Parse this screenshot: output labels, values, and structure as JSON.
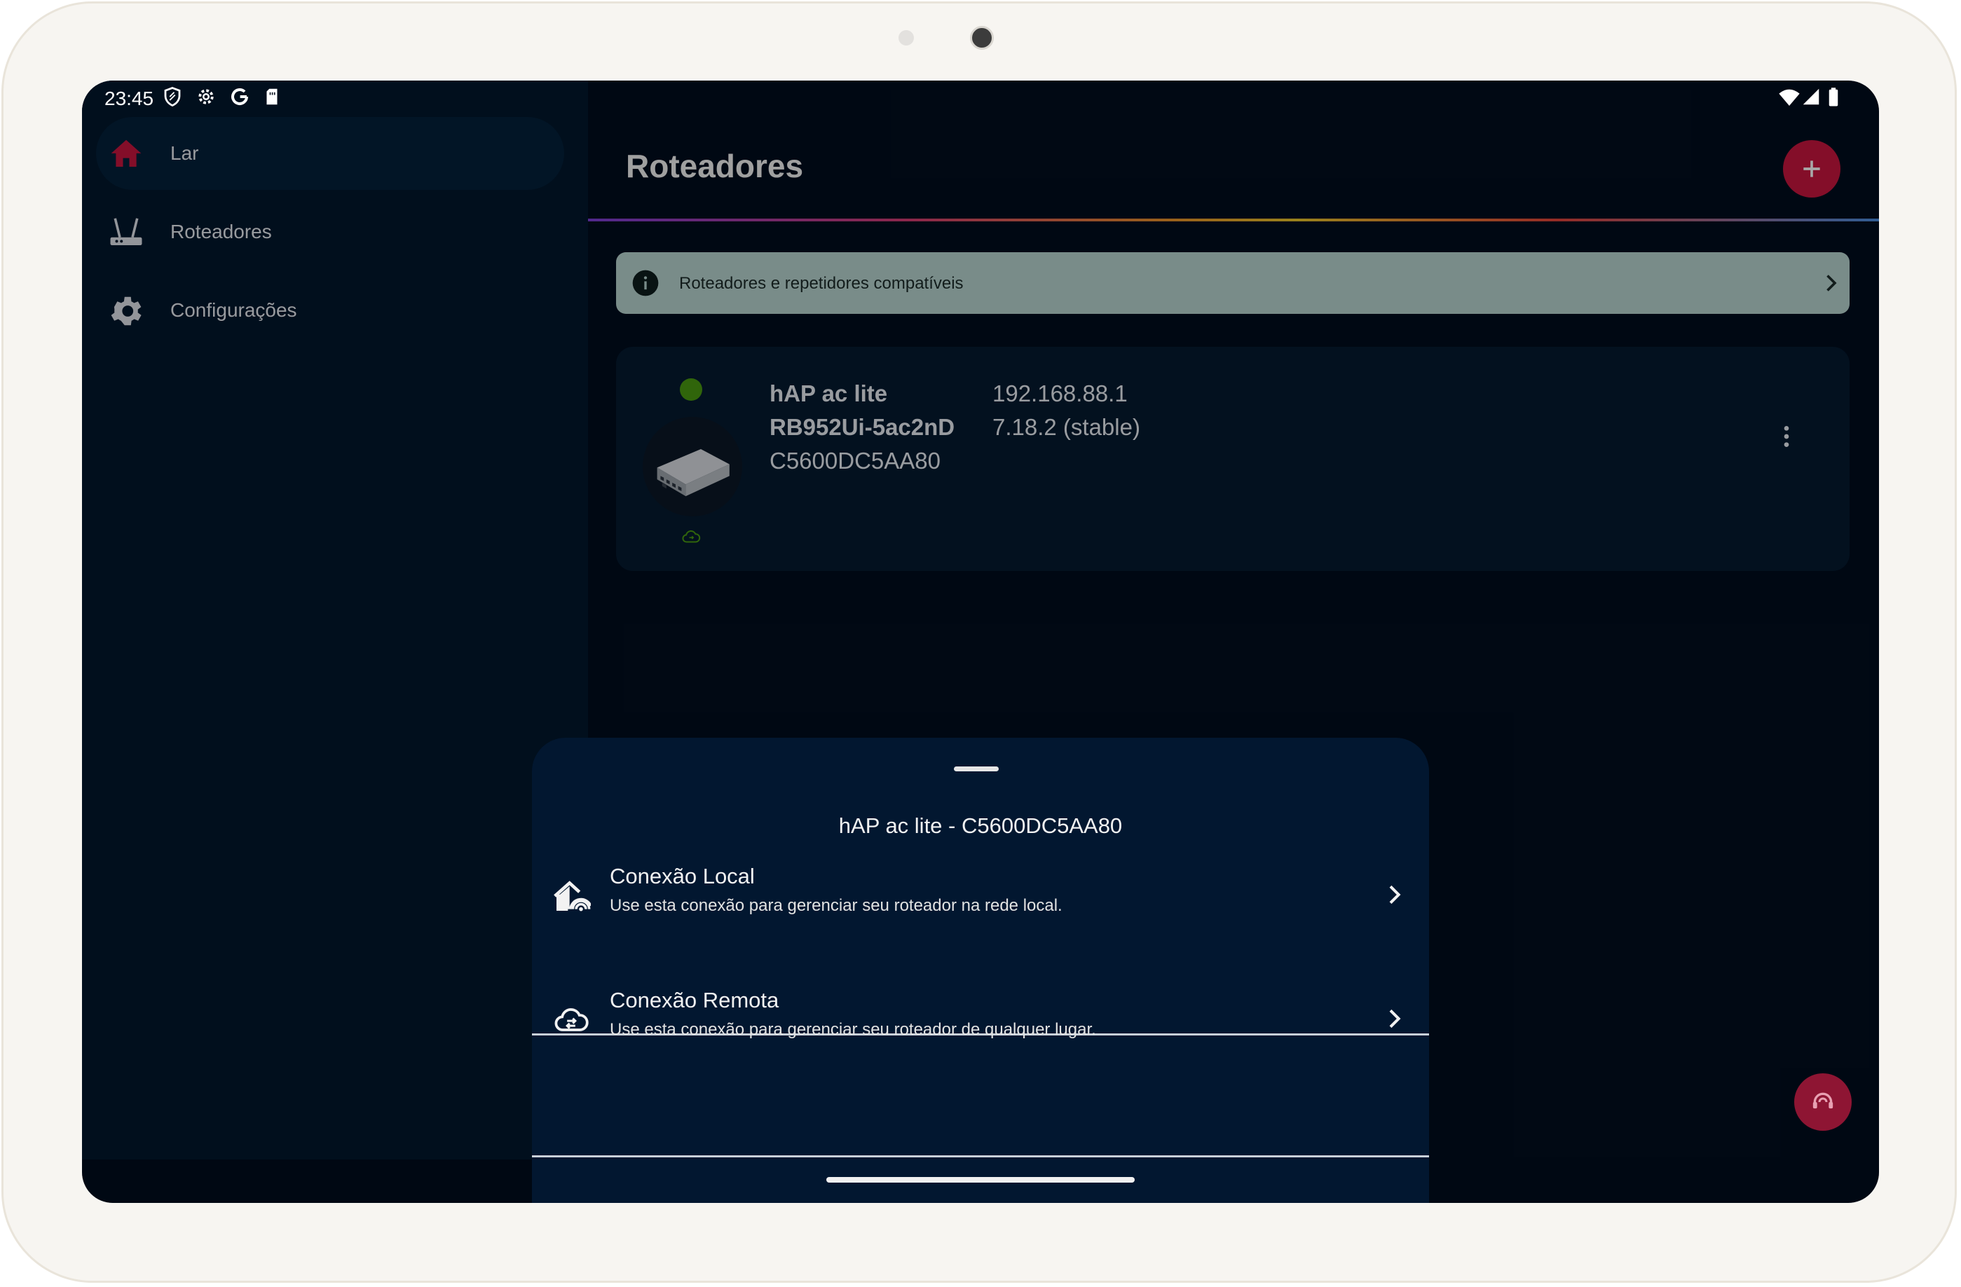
{
  "status_bar": {
    "time": "23:45"
  },
  "nav": {
    "items": [
      {
        "label": "Lar",
        "icon": "home-icon",
        "active": true
      },
      {
        "label": "Roteadores",
        "icon": "router-icon",
        "active": false
      },
      {
        "label": "Configurações",
        "icon": "gear-icon",
        "active": false
      }
    ]
  },
  "header": {
    "title": "Roteadores",
    "add_icon": "plus-icon"
  },
  "banner": {
    "text": "Roteadores e repetidores compatíveis",
    "icon": "info-icon"
  },
  "router_card": {
    "model": "hAP ac lite",
    "board": "RB952Ui-5ac2nD",
    "serial": "C5600DC5AA80",
    "ip": "192.168.88.1",
    "version": "7.18.2 (stable)",
    "status_color": "#4a9a12"
  },
  "sheet": {
    "title": "hAP ac lite - C5600DC5AA80",
    "options": [
      {
        "title": "Conexão Local",
        "subtitle": "Use esta conexão para gerenciar seu roteador na rede local.",
        "icon": "local-connection-icon"
      },
      {
        "title": "Conexão Remota",
        "subtitle": "Use esta conexão para gerenciar seu roteador de qualquer lugar.",
        "icon": "cloud-sync-icon"
      }
    ]
  },
  "colors": {
    "accent": "#c8163f",
    "background": "#010d1e",
    "sidebar": "#03172c",
    "banner": "#b8d5d0"
  }
}
